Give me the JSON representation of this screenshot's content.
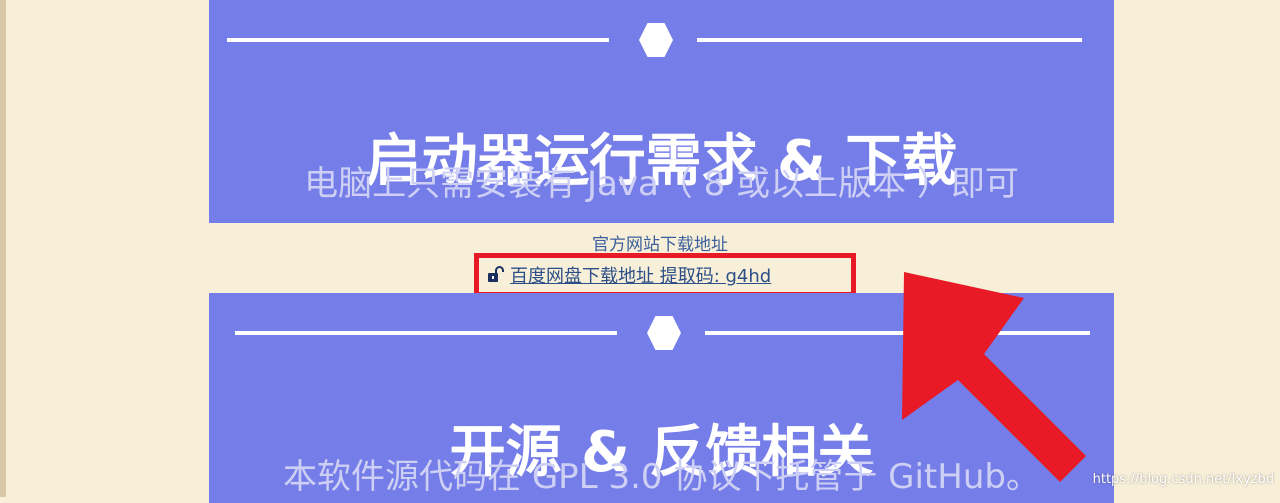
{
  "panels": [
    {
      "title": "启动器运行需求 & 下载",
      "subtitle": "电脑上只需安装有 Java（ 8 或以上版本 ）即可"
    },
    {
      "title": "开源 & 反馈相关",
      "subtitle": "本软件源代码在 GPL 3.0 协议下托管于 GitHub。"
    }
  ],
  "links": {
    "official": "官方网站下载地址",
    "baidu": "百度网盘下载地址 提取码: g4hd"
  },
  "watermark": "https://blog.csdn.net/lxyzbd",
  "colors": {
    "panel_bg": "#757de8",
    "page_bg": "#f8efd9",
    "highlight": "#e81a25",
    "link": "#2c4f87"
  },
  "icons": {
    "divider": "hexagon-icon",
    "link": "unlock-icon",
    "annotation": "red-arrow-icon"
  }
}
